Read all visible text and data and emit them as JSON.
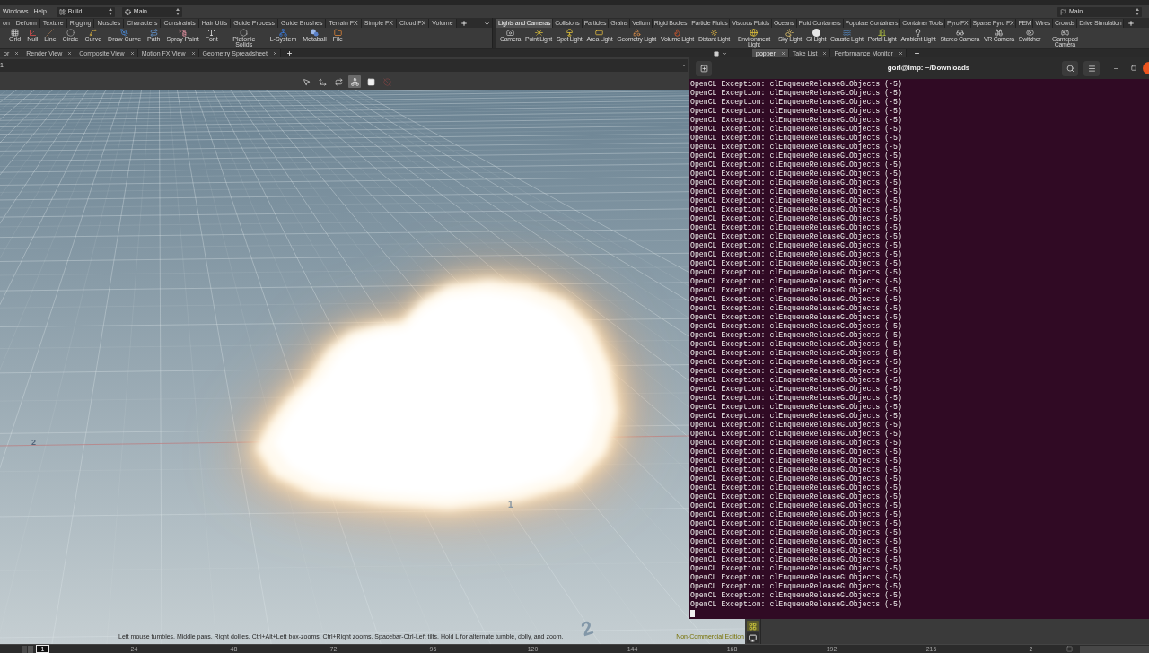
{
  "menu": [
    "Windows",
    "Help"
  ],
  "desktop_selector": {
    "value": "Build"
  },
  "context_selector": {
    "value": "Main"
  },
  "right_selector": {
    "value": "Main"
  },
  "shelf_left": {
    "tabs": [
      {
        "label": "on"
      },
      {
        "label": "Deform"
      },
      {
        "label": "Texture"
      },
      {
        "label": "Rigging"
      },
      {
        "label": "Muscles"
      },
      {
        "label": "Characters"
      },
      {
        "label": "Constraints"
      },
      {
        "label": "Hair Utils"
      },
      {
        "label": "Guide Process"
      },
      {
        "label": "Guide Brushes"
      },
      {
        "label": "Terrain FX"
      },
      {
        "label": "Simple FX"
      },
      {
        "label": "Cloud FX"
      },
      {
        "label": "Volume"
      }
    ],
    "tools": [
      {
        "label": "Grid"
      },
      {
        "label": "Null"
      },
      {
        "label": "Line"
      },
      {
        "label": "Circle"
      },
      {
        "label": "Curve"
      },
      {
        "label": "Draw Curve"
      },
      {
        "label": "Path"
      },
      {
        "label": "Spray Paint"
      },
      {
        "label": "Font"
      },
      {
        "label": "Platonic Solids"
      },
      {
        "label": "L-System"
      },
      {
        "label": "Metaball"
      },
      {
        "label": "File"
      }
    ]
  },
  "shelf_right": {
    "tabs": [
      {
        "label": "Lights and Cameras",
        "selected": true
      },
      {
        "label": "Collisions",
        "selected": false
      },
      {
        "label": "Particles",
        "selected": false
      },
      {
        "label": "Grains",
        "selected": false
      },
      {
        "label": "Vellum",
        "selected": false
      },
      {
        "label": "Rigid Bodies",
        "selected": false
      },
      {
        "label": "Particle Fluids",
        "selected": false
      },
      {
        "label": "Viscous Fluids",
        "selected": false
      },
      {
        "label": "Oceans",
        "selected": false
      },
      {
        "label": "Fluid Containers",
        "selected": false
      },
      {
        "label": "Populate Containers",
        "selected": false
      },
      {
        "label": "Container Tools",
        "selected": false
      },
      {
        "label": "Pyro FX",
        "selected": false
      },
      {
        "label": "Sparse Pyro FX",
        "selected": false
      },
      {
        "label": "FEM",
        "selected": false
      },
      {
        "label": "Wires",
        "selected": false
      },
      {
        "label": "Crowds",
        "selected": false
      },
      {
        "label": "Drive Simulation",
        "selected": false
      }
    ],
    "tools": [
      {
        "label": "Camera"
      },
      {
        "label": "Point Light"
      },
      {
        "label": "Spot Light"
      },
      {
        "label": "Area Light"
      },
      {
        "label": "Geometry Light"
      },
      {
        "label": "Volume Light"
      },
      {
        "label": "Distant Light"
      },
      {
        "label": "Environment Light"
      },
      {
        "label": "Sky Light"
      },
      {
        "label": "GI Light"
      },
      {
        "label": "Caustic Light"
      },
      {
        "label": "Portal Light"
      },
      {
        "label": "Ambient Light"
      },
      {
        "label": "Stereo Camera"
      },
      {
        "label": "VR Camera"
      },
      {
        "label": "Switcher"
      },
      {
        "label": "Gamepad Camera"
      }
    ]
  },
  "pane_tabs_left": [
    {
      "label": "or"
    },
    {
      "label": "Render View"
    },
    {
      "label": "Composite View"
    },
    {
      "label": "Motion FX View"
    },
    {
      "label": "Geometry Spreadsheet"
    }
  ],
  "pane_tabs_right": [
    {
      "label": "popper",
      "selected": true
    },
    {
      "label": "Take List",
      "selected": false
    },
    {
      "label": "Performance Monitor",
      "selected": false
    }
  ],
  "path_bar": {
    "value": "1"
  },
  "viewport_tools": [
    {
      "selected": false,
      "disabled": false
    },
    {
      "selected": false,
      "disabled": false
    },
    {
      "selected": false,
      "disabled": false
    },
    {
      "selected": true,
      "disabled": false
    },
    {
      "selected": false,
      "disabled": false
    },
    {
      "selected": false,
      "disabled": true
    }
  ],
  "viewport": {
    "grid_labels": [
      "2",
      "1",
      "2"
    ],
    "help_text": "Left mouse tumbles. Middle pans. Right dollies. Ctrl+Alt+Left box-zooms. Ctrl+Right zooms. Spacebar-Ctrl-Left tilts. Hold L for alternate tumble, dolly, and zoom.",
    "edition": "Non-Commercial Edition"
  },
  "side_tools": [
    {
      "selected": true
    },
    {
      "selected": false
    }
  ],
  "timeline": {
    "frame": "1",
    "ticks": [
      "24",
      "48",
      "72",
      "96",
      "120",
      "144",
      "168",
      "192",
      "216",
      "2"
    ]
  },
  "terminal": {
    "title": "gorl@imp: ~/Downloads",
    "cursor": true,
    "lines": [
      "OpenCL Exception: clEnqueueReleaseGLObjects (-5)",
      "OpenCL Exception: clEnqueueReleaseGLObjects (-5)",
      "OpenCL Exception: clEnqueueReleaseGLObjects (-5)",
      "OpenCL Exception: clEnqueueReleaseGLObjects (-5)",
      "OpenCL Exception: clEnqueueReleaseGLObjects (-5)",
      "OpenCL Exception: clEnqueueReleaseGLObjects (-5)",
      "OpenCL Exception: clEnqueueReleaseGLObjects (-5)",
      "OpenCL Exception: clEnqueueReleaseGLObjects (-5)",
      "OpenCL Exception: clEnqueueReleaseGLObjects (-5)",
      "OpenCL Exception: clEnqueueReleaseGLObjects (-5)",
      "OpenCL Exception: clEnqueueReleaseGLObjects (-5)",
      "OpenCL Exception: clEnqueueReleaseGLObjects (-5)",
      "OpenCL Exception: clEnqueueReleaseGLObjects (-5)",
      "OpenCL Exception: clEnqueueReleaseGLObjects (-5)",
      "OpenCL Exception: clEnqueueReleaseGLObjects (-5)",
      "OpenCL Exception: clEnqueueReleaseGLObjects (-5)",
      "OpenCL Exception: clEnqueueReleaseGLObjects (-5)",
      "OpenCL Exception: clEnqueueReleaseGLObjects (-5)",
      "OpenCL Exception: clEnqueueReleaseGLObjects (-5)",
      "OpenCL Exception: clEnqueueReleaseGLObjects (-5)",
      "OpenCL Exception: clEnqueueReleaseGLObjects (-5)",
      "OpenCL Exception: clEnqueueReleaseGLObjects (-5)",
      "OpenCL Exception: clEnqueueReleaseGLObjects (-5)",
      "OpenCL Exception: clEnqueueReleaseGLObjects (-5)",
      "OpenCL Exception: clEnqueueReleaseGLObjects (-5)",
      "OpenCL Exception: clEnqueueReleaseGLObjects (-5)",
      "OpenCL Exception: clEnqueueReleaseGLObjects (-5)",
      "OpenCL Exception: clEnqueueReleaseGLObjects (-5)",
      "OpenCL Exception: clEnqueueReleaseGLObjects (-5)",
      "OpenCL Exception: clEnqueueReleaseGLObjects (-5)",
      "OpenCL Exception: clEnqueueReleaseGLObjects (-5)",
      "OpenCL Exception: clEnqueueReleaseGLObjects (-5)",
      "OpenCL Exception: clEnqueueReleaseGLObjects (-5)",
      "OpenCL Exception: clEnqueueReleaseGLObjects (-5)",
      "OpenCL Exception: clEnqueueReleaseGLObjects (-5)",
      "OpenCL Exception: clEnqueueReleaseGLObjects (-5)",
      "OpenCL Exception: clEnqueueReleaseGLObjects (-5)",
      "OpenCL Exception: clEnqueueReleaseGLObjects (-5)",
      "OpenCL Exception: clEnqueueReleaseGLObjects (-5)",
      "OpenCL Exception: clEnqueueReleaseGLObjects (-5)",
      "OpenCL Exception: clEnqueueReleaseGLObjects (-5)",
      "OpenCL Exception: clEnqueueReleaseGLObjects (-5)",
      "OpenCL Exception: clEnqueueReleaseGLObjects (-5)",
      "OpenCL Exception: clEnqueueReleaseGLObjects (-5)",
      "OpenCL Exception: clEnqueueReleaseGLObjects (-5)",
      "OpenCL Exception: clEnqueueReleaseGLObjects (-5)",
      "OpenCL Exception: clEnqueueReleaseGLObjects (-5)",
      "OpenCL Exception: clEnqueueReleaseGLObjects (-5)",
      "OpenCL Exception: clEnqueueReleaseGLObjects (-5)",
      "OpenCL Exception: clEnqueueReleaseGLObjects (-5)",
      "OpenCL Exception: clEnqueueReleaseGLObjects (-5)",
      "OpenCL Exception: clEnqueueReleaseGLObjects (-5)",
      "OpenCL Exception: clEnqueueReleaseGLObjects (-5)",
      "OpenCL Exception: clEnqueueReleaseGLObjects (-5)",
      "OpenCL Exception: clEnqueueReleaseGLObjects (-5)",
      "OpenCL Exception: clEnqueueReleaseGLObjects (-5)",
      "OpenCL Exception: clEnqueueReleaseGLObjects (-5)",
      "OpenCL Exception: clEnqueueReleaseGLObjects (-5)",
      "OpenCL Exception: clEnqueueReleaseGLObjects (-5)"
    ]
  }
}
